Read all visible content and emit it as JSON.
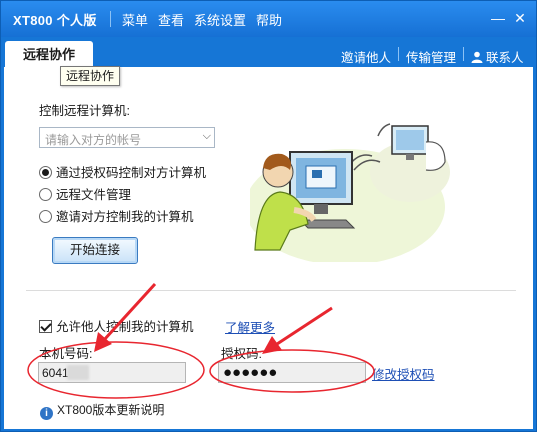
{
  "titlebar": {
    "app_title": "XT800 个人版",
    "menus": [
      "菜单",
      "查看",
      "系统设置",
      "帮助"
    ]
  },
  "tabs": {
    "active": "远程协作",
    "tooltip": "远程协作",
    "invite": "邀请他人",
    "transfer": "传输管理",
    "contacts": "联系人"
  },
  "control": {
    "label": "控制远程计算机:",
    "account_placeholder": "请输入对方的帐号",
    "options": [
      {
        "label": "通过授权码控制对方计算机",
        "selected": true
      },
      {
        "label": "远程文件管理",
        "selected": false
      },
      {
        "label": "邀请对方控制我的计算机",
        "selected": false
      }
    ],
    "connect_button": "开始连接"
  },
  "allow": {
    "label": "允许他人控制我的计算机",
    "checked": true,
    "learn_more": "了解更多"
  },
  "machine": {
    "id_label": "本机号码:",
    "id_value": "6041",
    "auth_label": "授权码:",
    "auth_value": "●●●●●●",
    "modify_link": "修改授权码"
  },
  "update": {
    "text": "XT800版本更新说明"
  },
  "colors": {
    "titlebar": "#1676d6",
    "link": "#1e4fb5",
    "annotation": "#e8262f"
  },
  "icons": {
    "minimize": "minimize-icon",
    "close": "close-icon",
    "contacts": "person-icon",
    "info": "info-icon"
  }
}
